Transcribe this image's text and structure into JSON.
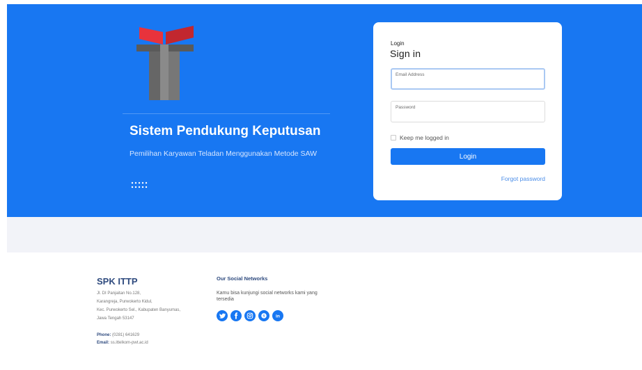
{
  "hero": {
    "title": "Sistem Pendukung Keputusan",
    "subtitle": "Pemilihan Karyawan Teladan Menggunakan Metode SAW",
    "logo_icon": "telkom-university-logo",
    "decor_icon": "dots-grid-icon"
  },
  "login": {
    "eyebrow": "Login",
    "title": "Sign in",
    "email_placeholder": "Email Address",
    "password_placeholder": "Password",
    "remember_label": "Keep me logged in",
    "button_label": "Login",
    "forgot_label": "Forgot password"
  },
  "footer": {
    "brand": "SPK ITTP",
    "address_lines": [
      "Jl. DI Panjaitan No.128,",
      "Karangreja, Purwokerto Kidul,",
      "Kec. Purwokerto Sel., Kabupaten Banyumas,",
      "Jawa Tengah 53147"
    ],
    "phone_label": "Phone:",
    "phone": "(0281) 641629",
    "email_label": "Email:",
    "email": "ss.ittelkom-pwt.ac.id",
    "social_title": "Our Social Networks",
    "social_text": "Kamu bisa kunjungi social networks kami yang tersedia",
    "social_icons": [
      "twitter-icon",
      "facebook-icon",
      "instagram-icon",
      "skype-icon",
      "linkedin-icon"
    ]
  },
  "colors": {
    "primary": "#1877f2",
    "footer_heading": "#2e4a7e",
    "band": "#f2f3f8"
  }
}
